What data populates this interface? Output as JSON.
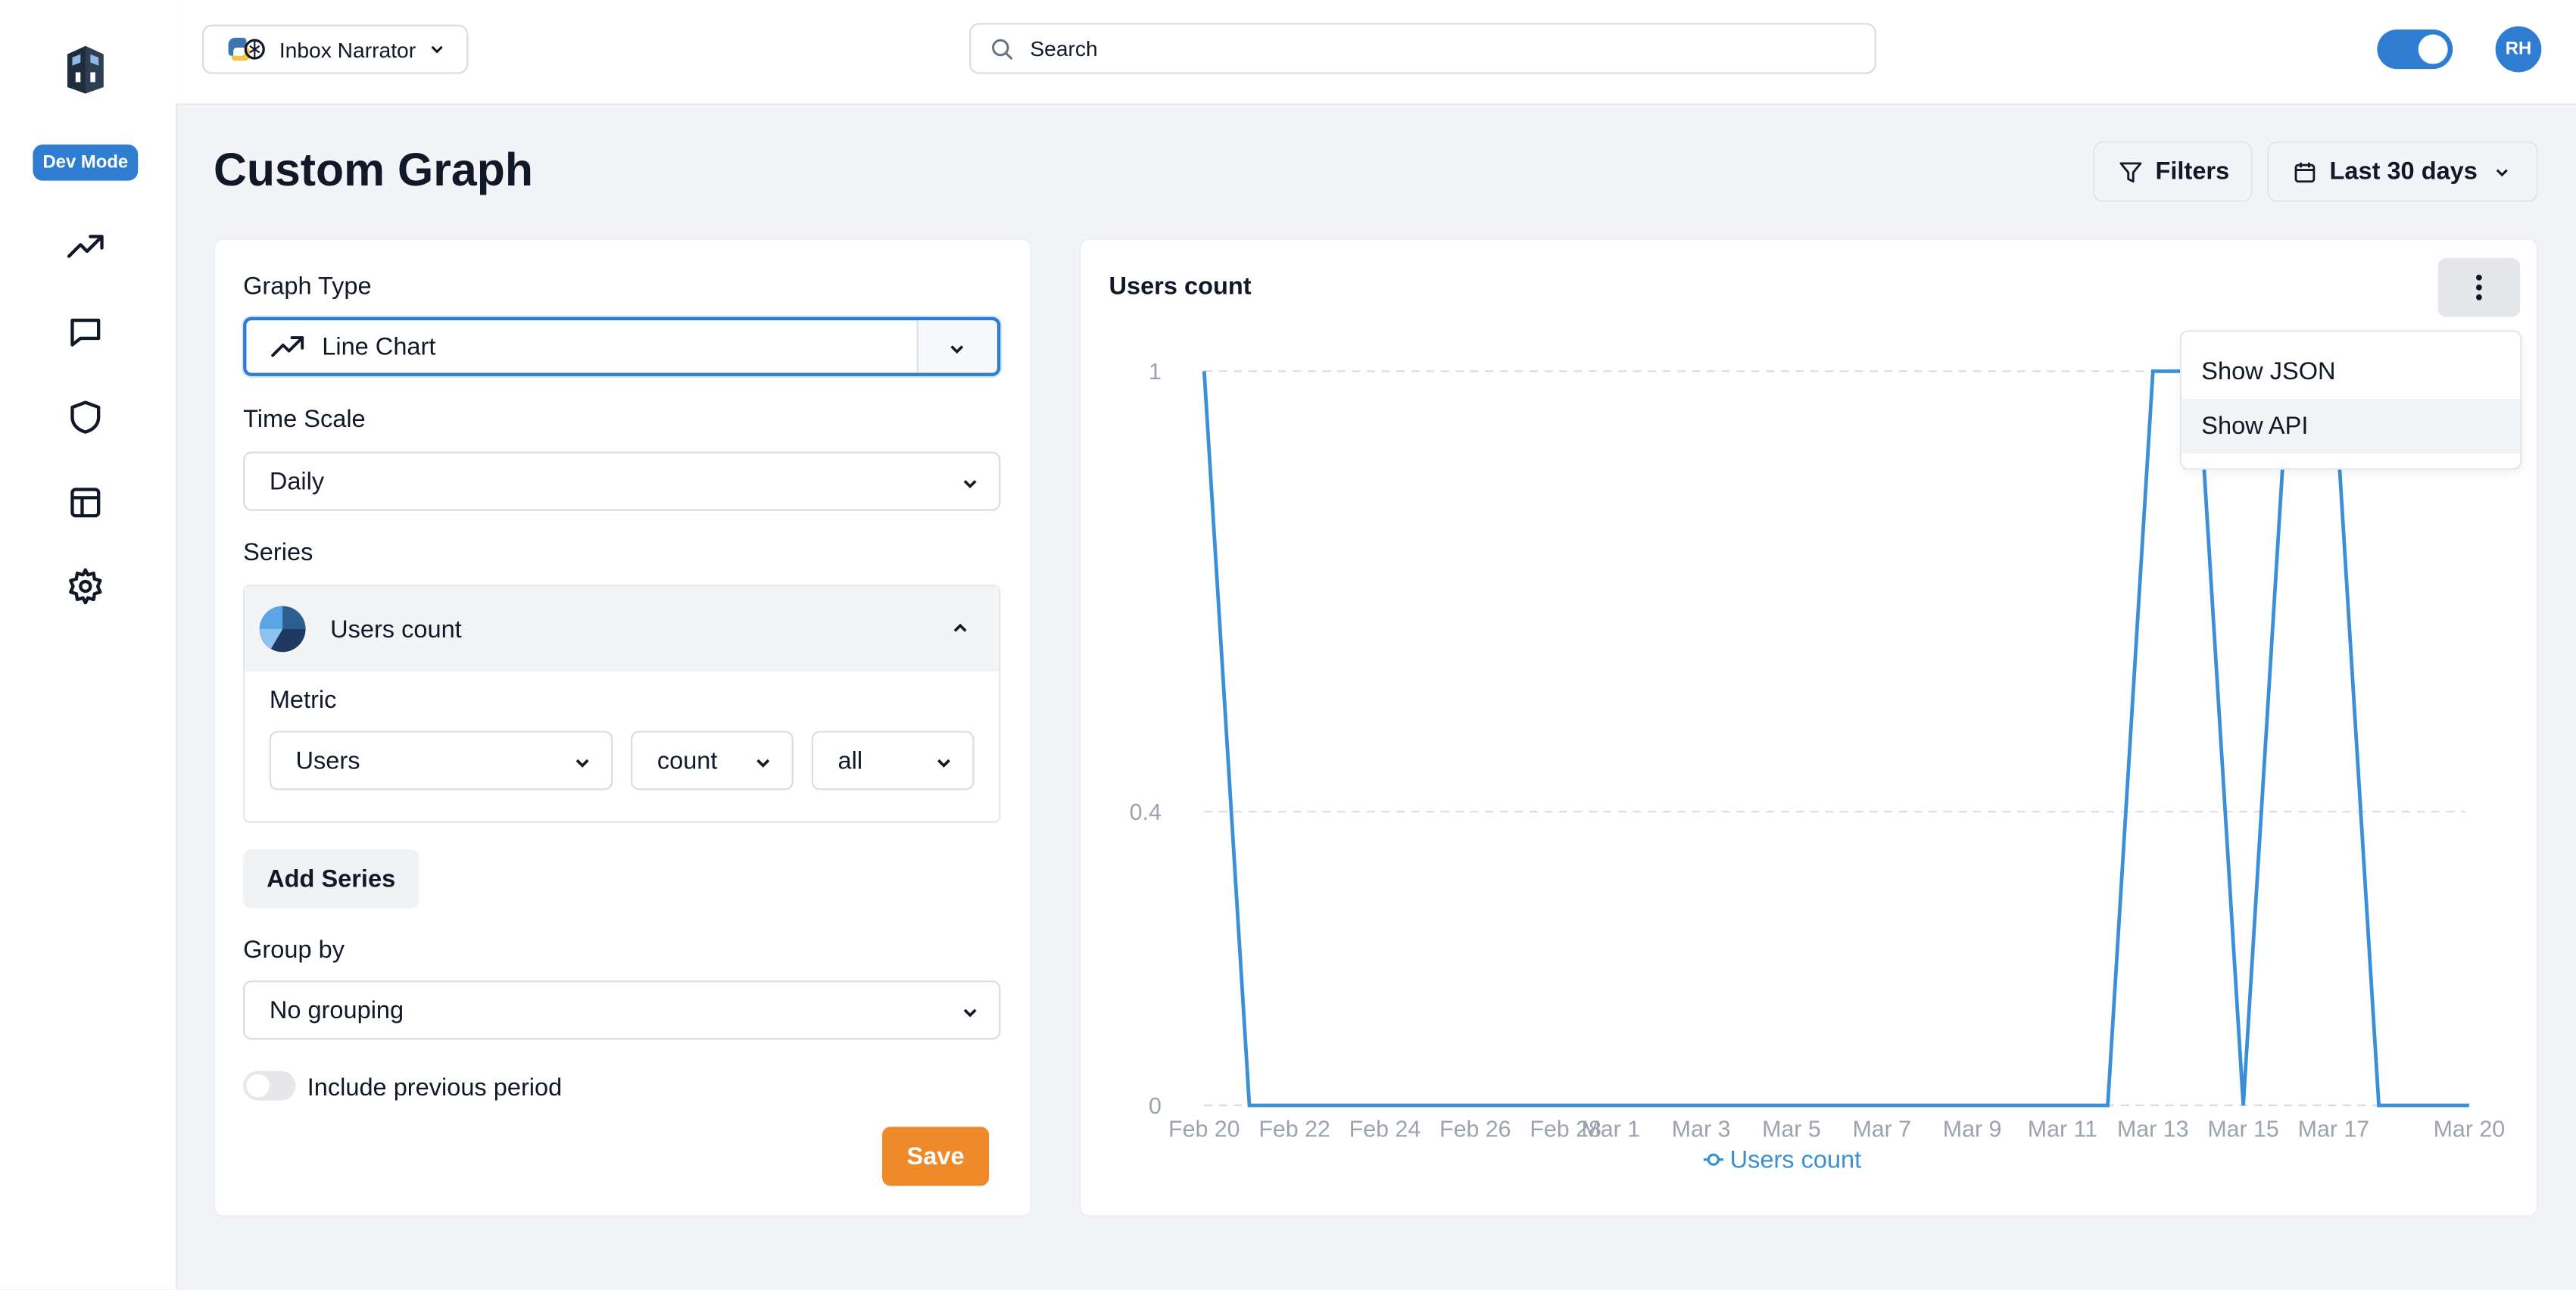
{
  "sidebar": {
    "dev_badge": "Dev Mode",
    "items": [
      {
        "icon": "trending-up-icon"
      },
      {
        "icon": "message-icon"
      },
      {
        "icon": "shield-icon"
      },
      {
        "icon": "table-icon"
      },
      {
        "icon": "gear-icon"
      }
    ]
  },
  "topbar": {
    "project_name": "Inbox Narrator",
    "search_placeholder": "Search",
    "avatar_initials": "RH"
  },
  "page": {
    "title": "Custom Graph",
    "filters_label": "Filters",
    "date_range_label": "Last 30 days"
  },
  "form": {
    "graph_type_label": "Graph Type",
    "graph_type_value": "Line Chart",
    "time_scale_label": "Time Scale",
    "time_scale_value": "Daily",
    "series_label": "Series",
    "series_name": "Users count",
    "metric_label": "Metric",
    "metric_entity": "Users",
    "metric_agg": "count",
    "metric_filter": "all",
    "add_series_label": "Add Series",
    "group_by_label": "Group by",
    "group_by_value": "No grouping",
    "include_prev_label": "Include previous period",
    "save_label": "Save"
  },
  "menu": {
    "items": [
      "Show JSON",
      "Show API"
    ]
  },
  "colors": {
    "accent": "#2f7dd1",
    "save": "#ee8a2a",
    "line": "#3b8fd6"
  },
  "chart_data": {
    "type": "line",
    "title": "Users count",
    "x": [
      "Feb 20",
      "Feb 21",
      "Feb 22",
      "Feb 23",
      "Feb 24",
      "Feb 25",
      "Feb 26",
      "Feb 27",
      "Feb 28",
      "Mar 1",
      "Mar 2",
      "Mar 3",
      "Mar 4",
      "Mar 5",
      "Mar 6",
      "Mar 7",
      "Mar 8",
      "Mar 9",
      "Mar 10",
      "Mar 11",
      "Mar 12",
      "Mar 13",
      "Mar 14",
      "Mar 15",
      "Mar 16",
      "Mar 17",
      "Mar 18",
      "Mar 19",
      "Mar 20"
    ],
    "x_ticks": [
      "Feb 20",
      "Feb 22",
      "Feb 24",
      "Feb 26",
      "Feb 28",
      "Mar 1",
      "Mar 3",
      "Mar 5",
      "Mar 7",
      "Mar 9",
      "Mar 11",
      "Mar 13",
      "Mar 15",
      "Mar 17",
      "Mar 20"
    ],
    "series": [
      {
        "name": "Users count",
        "values": [
          1,
          0,
          0,
          0,
          0,
          0,
          0,
          0,
          0,
          0,
          0,
          0,
          0,
          0,
          0,
          0,
          0,
          0,
          0,
          0,
          0,
          1,
          1,
          0,
          1,
          1,
          0,
          0,
          0
        ]
      }
    ],
    "y_ticks": [
      0,
      0.4,
      1
    ],
    "ylim": [
      0,
      1
    ],
    "grid": "horizontal-dashed",
    "legend": "bottom-center"
  }
}
